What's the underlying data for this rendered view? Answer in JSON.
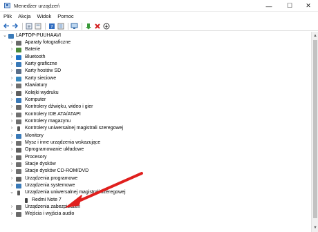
{
  "window": {
    "title": "Menedżer urządzeń",
    "minimize_glyph": "—",
    "maximize_glyph": "☐",
    "close_glyph": "✕"
  },
  "menu": [
    "Plik",
    "Akcja",
    "Widok",
    "Pomoc"
  ],
  "toolbar": {
    "buttons": [
      "back-arrow-icon",
      "forward-arrow-icon",
      "properties-icon",
      "show-hidden-icon",
      "help-icon",
      "details-icon",
      "scan-icon",
      "update-driver-icon",
      "uninstall-icon",
      "disable-icon"
    ]
  },
  "tree": {
    "root": "LAPTOP-PUUHAAVI",
    "categories": [
      {
        "label": "Aparaty fotograficzne",
        "icon": "camera-icon",
        "color": "#6a6a6a"
      },
      {
        "label": "Baterie",
        "icon": "battery-icon",
        "color": "#4a8a3a"
      },
      {
        "label": "Bluetooth",
        "icon": "bluetooth-icon",
        "color": "#1e73c8"
      },
      {
        "label": "Karty graficzne",
        "icon": "display-adapter-icon",
        "color": "#3a7ab8"
      },
      {
        "label": "Karty hostów SD",
        "icon": "sd-host-icon",
        "color": "#5a6e88"
      },
      {
        "label": "Karty sieciowe",
        "icon": "network-adapter-icon",
        "color": "#3a8ac0"
      },
      {
        "label": "Klawiatury",
        "icon": "keyboard-icon",
        "color": "#707070"
      },
      {
        "label": "Kolejki wydruku",
        "icon": "print-queue-icon",
        "color": "#606060"
      },
      {
        "label": "Komputer",
        "icon": "computer-icon",
        "color": "#3a7ab8"
      },
      {
        "label": "Kontrolery dźwięku, wideo i gier",
        "icon": "sound-icon",
        "color": "#6a6a6a"
      },
      {
        "label": "Kontrolery IDE ATA/ATAPI",
        "icon": "ide-controller-icon",
        "color": "#707070"
      },
      {
        "label": "Kontrolery magazynu",
        "icon": "storage-controller-icon",
        "color": "#707070"
      },
      {
        "label": "Kontrolery uniwersalnej magistrali szeregowej",
        "icon": "usb-controller-icon",
        "color": "#5a5a5a"
      },
      {
        "label": "Monitory",
        "icon": "monitor-icon",
        "color": "#3a7ab8"
      },
      {
        "label": "Mysz i inne urządzenia wskazujące",
        "icon": "mouse-icon",
        "color": "#707070"
      },
      {
        "label": "Oprogramowanie układowe",
        "icon": "firmware-icon",
        "color": "#606060"
      },
      {
        "label": "Procesory",
        "icon": "processor-icon",
        "color": "#6a6a6a"
      },
      {
        "label": "Stacje dysków",
        "icon": "disk-drive-icon",
        "color": "#707070"
      },
      {
        "label": "Stacje dysków CD-ROM/DVD",
        "icon": "dvd-drive-icon",
        "color": "#707070"
      },
      {
        "label": "Urządzenia programowe",
        "icon": "software-device-icon",
        "color": "#606060"
      },
      {
        "label": "Urządzenia systemowe",
        "icon": "system-device-icon",
        "color": "#3a7ab8"
      },
      {
        "label": "Urządzenia uniwersalnej magistrali szeregowej",
        "icon": "usb-device-icon",
        "color": "#5a5a5a",
        "expanded": true
      },
      {
        "label": "Redmi Note 7",
        "icon": "phone-icon",
        "color": "#444444",
        "child": true
      },
      {
        "label": "Urządzenia zabezpieczeń",
        "icon": "security-device-icon",
        "color": "#707070"
      },
      {
        "label": "Wejścia i wyjścia audio",
        "icon": "audio-io-icon",
        "color": "#6a6a6a"
      }
    ]
  },
  "annotation": {
    "color": "#e0201e",
    "points_to": "Redmi Note 7"
  }
}
